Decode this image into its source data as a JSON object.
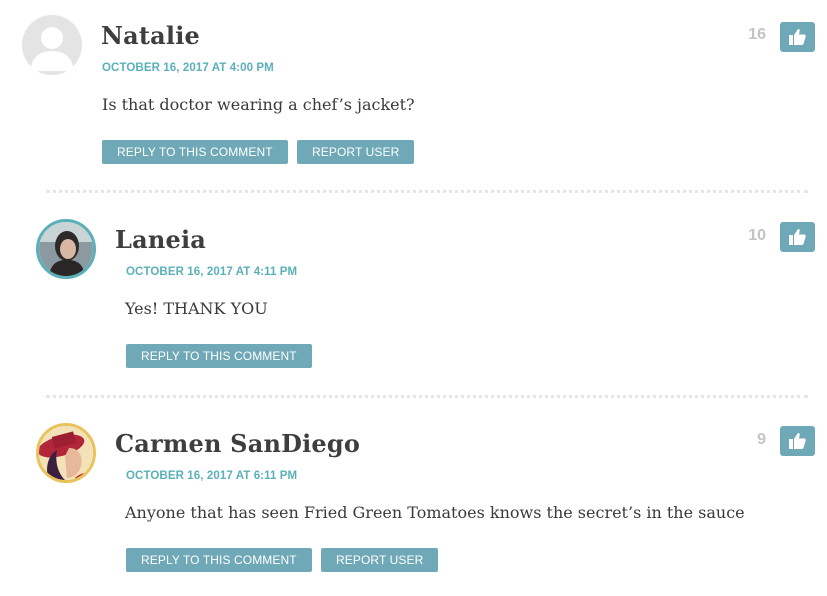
{
  "colors": {
    "accent": "#5ab0b9",
    "button": "#6fa8b6",
    "count": "#c4c4c4",
    "text": "#3a3a3a"
  },
  "comments": [
    {
      "author": "Natalie",
      "date": "OCTOBER 16, 2017 AT 4:00 PM",
      "text": "Is that doctor wearing a chef’s jacket?",
      "likes": "16",
      "reply_label": "REPLY TO THIS COMMENT",
      "report_label": "REPORT USER",
      "avatar": "default-avatar-icon"
    },
    {
      "author": "Laneia",
      "date": "OCTOBER 16, 2017 AT 4:11 PM",
      "text": "Yes! THANK YOU",
      "likes": "10",
      "reply_label": "REPLY TO THIS COMMENT",
      "avatar": "photo-avatar"
    },
    {
      "author": "Carmen SanDiego",
      "date": "OCTOBER 16, 2017 AT 6:11 PM",
      "text": "Anyone that has seen Fried Green Tomatoes knows the secret’s in the sauce",
      "likes": "9",
      "reply_label": "REPLY TO THIS COMMENT",
      "report_label": "REPORT USER",
      "avatar": "illustrated-avatar"
    }
  ]
}
